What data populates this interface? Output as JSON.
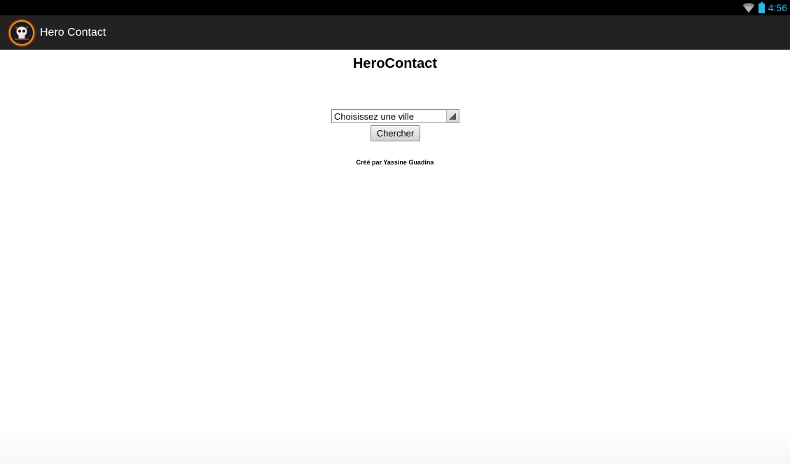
{
  "status_bar": {
    "time": "4:56",
    "icons": [
      "wifi-icon",
      "battery-icon"
    ],
    "clock_color": "#33b5e5"
  },
  "action_bar": {
    "logo": "skull-emblem-logo",
    "title": "Hero Contact",
    "background": "#222222"
  },
  "main": {
    "heading": "HeroContact",
    "city_select": {
      "selected": "Choisissez une ville"
    },
    "search_button": "Chercher",
    "credit": "Créé par Yassine Guadina"
  }
}
